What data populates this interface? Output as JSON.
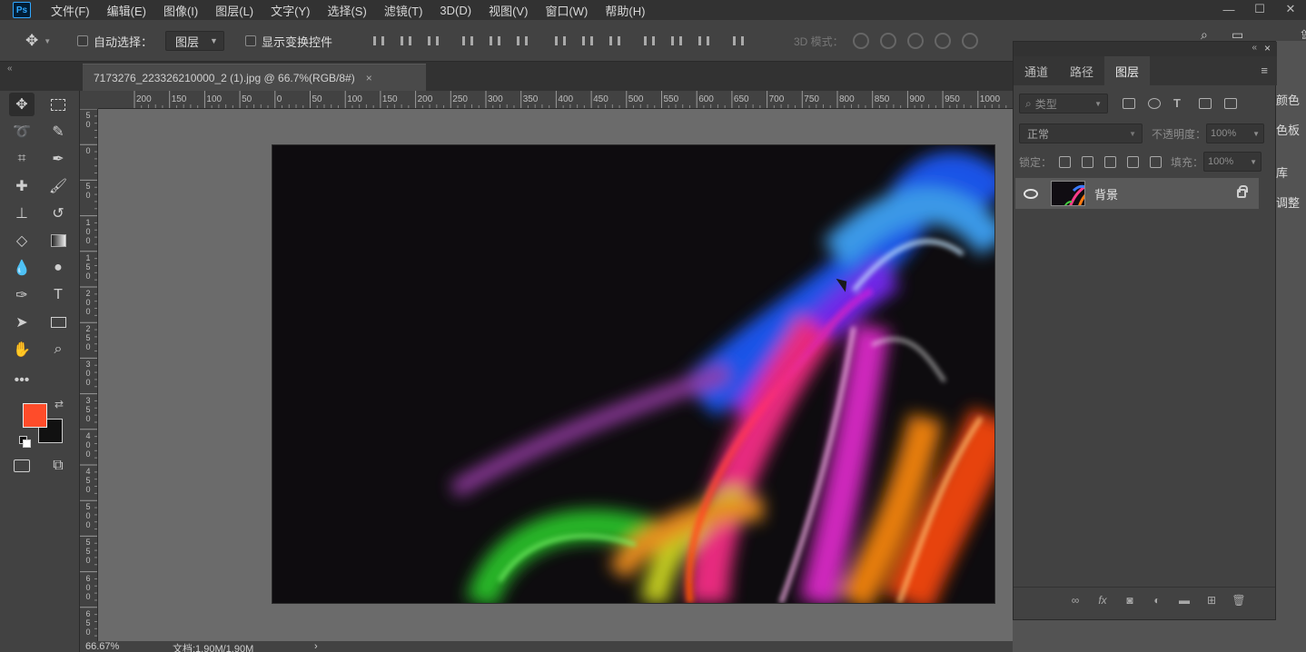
{
  "app": {
    "logo": "Ps"
  },
  "menu": [
    "文件(F)",
    "编辑(E)",
    "图像(I)",
    "图层(L)",
    "文字(Y)",
    "选择(S)",
    "滤镜(T)",
    "3D(D)",
    "视图(V)",
    "窗口(W)",
    "帮助(H)"
  ],
  "options": {
    "auto_select_label": "自动选择：",
    "auto_select_target": "图层",
    "show_transform_label": "显示变换控件",
    "mode3d_label": "3D 模式："
  },
  "document": {
    "tab_title": "7173276_223326210000_2 (1).jpg @ 66.7%(RGB/8#)",
    "close_glyph": "×"
  },
  "ruler_top_labels": [
    "200",
    "150",
    "100",
    "50",
    "0",
    "50",
    "100",
    "150",
    "200",
    "250",
    "300",
    "350",
    "400",
    "450",
    "500",
    "550",
    "600",
    "650",
    "700",
    "750",
    "800",
    "850",
    "900",
    "950",
    "1000"
  ],
  "ruler_left_labels": [
    "5\n0",
    "0",
    "5\n0",
    "1\n0\n0",
    "1\n5\n0",
    "2\n0\n0",
    "2\n5\n0",
    "3\n0\n0",
    "3\n5\n0",
    "4\n0\n0",
    "4\n5\n0",
    "5\n0\n0",
    "5\n5\n0",
    "6\n0\n0",
    "6\n5\n0"
  ],
  "colors": {
    "foreground": "#ff4c2a",
    "background": "#111111",
    "accent": "#31a8ff"
  },
  "status": {
    "zoom": "66.67%",
    "doc_info": "文档:1.90M/1.90M",
    "arrow": "›"
  },
  "layers_panel": {
    "tabs": [
      "通道",
      "路径",
      "图层"
    ],
    "active_tab": 2,
    "filter_placeholder": "类型",
    "blend_mode": "正常",
    "opacity_label": "不透明度：",
    "opacity_value": "100%",
    "lock_label": "锁定：",
    "fill_label": "填充：",
    "fill_value": "100%",
    "layers": [
      {
        "name": "背景",
        "visible": true,
        "locked": true
      }
    ]
  },
  "side_panels": [
    "颜色",
    "色板",
    "库",
    "调整"
  ]
}
